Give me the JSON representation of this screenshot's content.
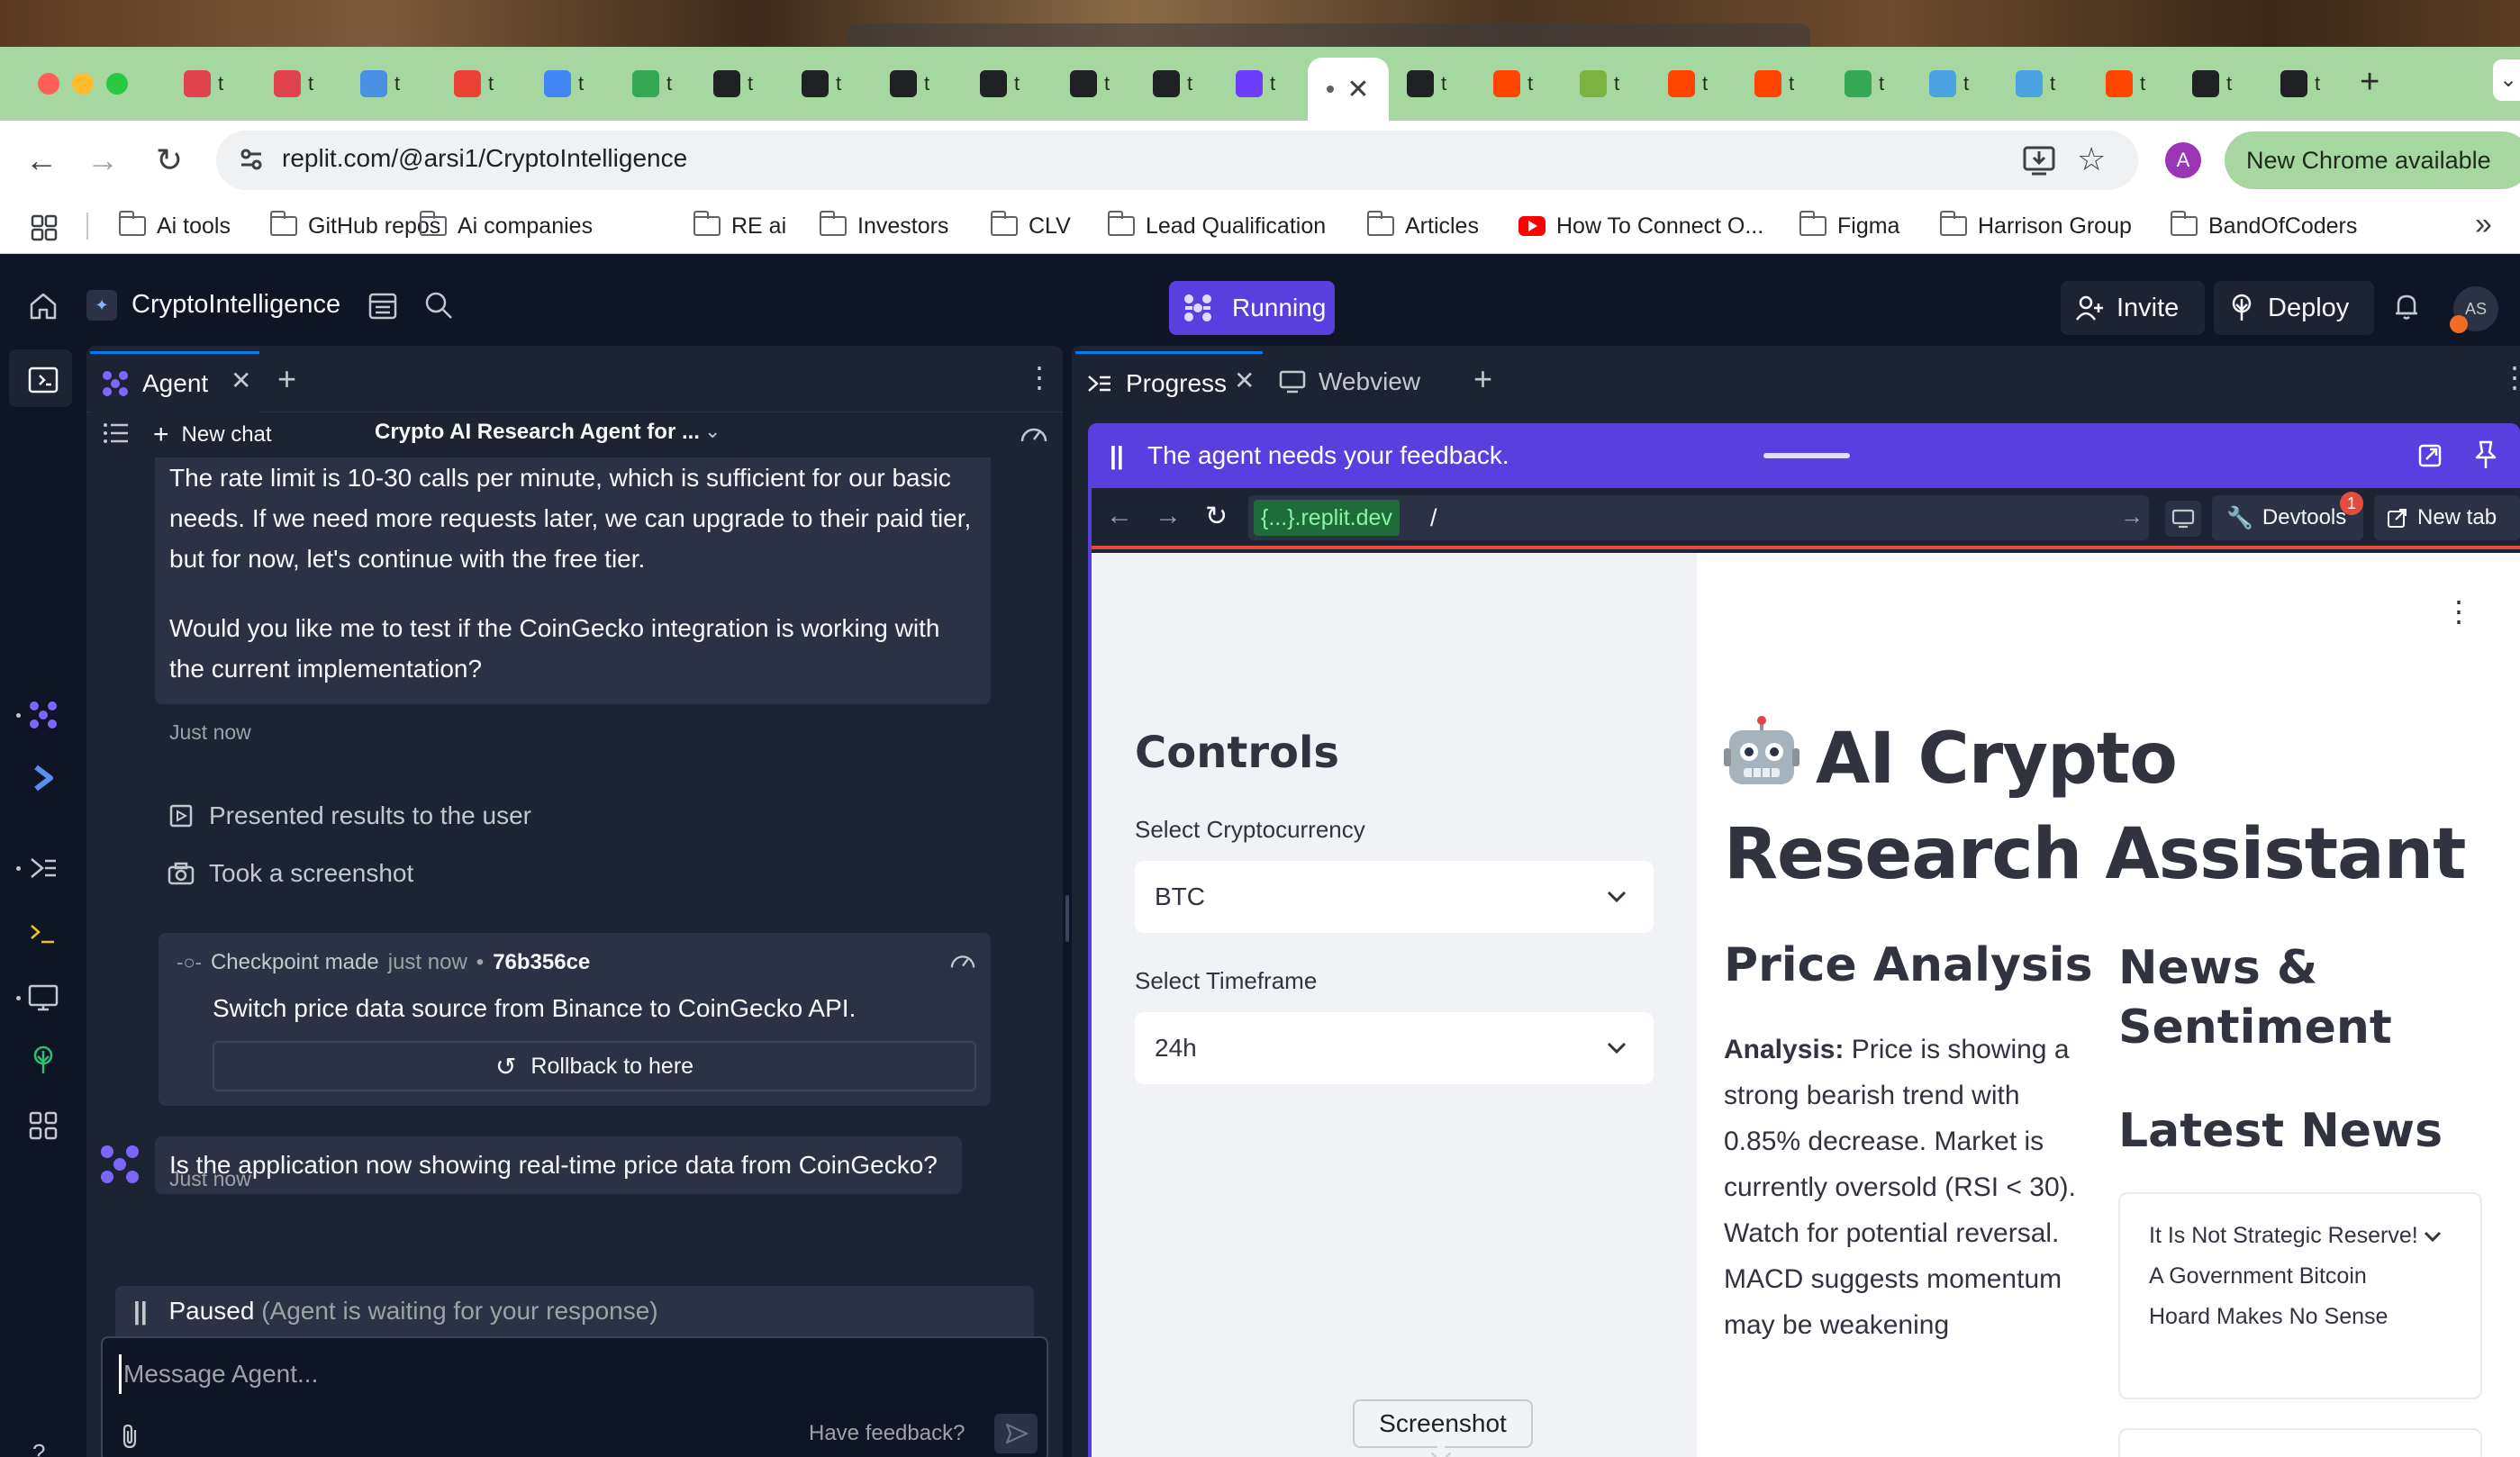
{
  "browser": {
    "url": "replit.com/@arsi1/CryptoIntelligence",
    "update_label": "New Chrome available",
    "profile_initial": "A",
    "tabs": [
      "t",
      "t",
      "t",
      "t",
      "t",
      "t",
      "t",
      "t",
      "t",
      "t",
      "t",
      "t",
      "t",
      "t",
      "t",
      "t",
      "t",
      "t",
      "t",
      "t",
      "t",
      "t",
      "t",
      "t"
    ],
    "bookmarks": [
      "Ai tools",
      "GitHub repos",
      "Ai companies",
      "RE ai",
      "Investors",
      "CLV",
      "Lead Qualification",
      "Articles",
      "How To Connect O...",
      "Figma",
      "Harrison Group",
      "BandOfCoders"
    ],
    "accent_color": "#a7d7a1"
  },
  "replit": {
    "repl_name": "CryptoIntelligence",
    "run_label": "Running",
    "invite_label": "Invite",
    "deploy_label": "Deploy",
    "avatar_initials": "AS"
  },
  "agent": {
    "tab_label": "Agent",
    "new_chat_label": "New chat",
    "chat_title": "Crypto AI Research Agent for ...",
    "msg1_p1": "The rate limit is 10-30 calls per minute, which is sufficient for our basic needs. If we need more requests later, we can upgrade to their paid tier, but for now, let's continue with the free tier.",
    "msg1_p2": "Would you like me to test if the CoinGecko integration is working with the current implementation?",
    "stamp1": "Just now",
    "action1": "Presented results to the user",
    "action2": "Took a screenshot",
    "checkpoint": {
      "made": "Checkpoint made",
      "when": "just now",
      "bullet": "•",
      "hash": "76b356ce",
      "message": "Switch price data source from Binance to CoinGecko API.",
      "rollback_label": "Rollback to here"
    },
    "user_msg": "Is the application now showing real-time price data from CoinGecko?",
    "stamp2": "Just now",
    "paused_label": "Paused",
    "paused_detail": "(Agent is waiting for your response)",
    "composer_placeholder": "Message Agent...",
    "feedback_label": "Have feedback?",
    "brand_color": "#5a3fe0"
  },
  "right": {
    "progress_tab": "Progress",
    "webview_tab": "Webview",
    "feedback_banner": "The agent needs your feedback.",
    "domain": "{...}.replit.dev",
    "path": "/",
    "devtools_label": "Devtools",
    "devtools_badge": "1",
    "new_tab_label": "New tab"
  },
  "app": {
    "controls_title": "Controls",
    "crypto_label": "Select Cryptocurrency",
    "crypto_value": "BTC",
    "timeframe_label": "Select Timeframe",
    "timeframe_value": "24h",
    "title": "AI Crypto Research Assistant",
    "price_title": "Price Analysis",
    "analysis_label": "Analysis:",
    "analysis_text": "Price is showing a strong bearish trend with 0.85% decrease. Market is currently oversold (RSI < 30). Watch for potential reversal. MACD suggests momentum may be weakening",
    "news_title": "News & Sentiment",
    "latest_title": "Latest News",
    "news_item": "It Is Not Strategic Reserve! A Government Bitcoin Hoard Makes No Sense"
  },
  "tooltip": "Screenshot"
}
